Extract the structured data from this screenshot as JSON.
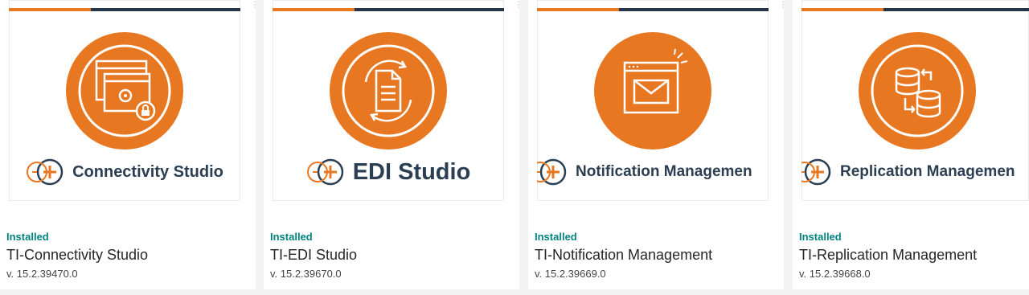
{
  "colors": {
    "accent": "#e87722",
    "navy": "#253447",
    "status_green": "#00827f",
    "page_bg": "#f3f3f3"
  },
  "cards": [
    {
      "brand": "Connectivity Studio",
      "icon": "connectivity-studio-icon",
      "status": "Installed",
      "name": "TI-Connectivity Studio",
      "version": "v. 15.2.39470.0"
    },
    {
      "brand": "EDI Studio",
      "icon": "edi-studio-icon",
      "status": "Installed",
      "name": "TI-EDI Studio",
      "version": "v. 15.2.39670.0"
    },
    {
      "brand": "Notification Managemen",
      "icon": "notification-management-icon",
      "status": "Installed",
      "name": "TI-Notification Management",
      "version": "v. 15.2.39669.0"
    },
    {
      "brand": "Replication Managemen",
      "icon": "replication-management-icon",
      "status": "Installed",
      "name": "TI-Replication Management",
      "version": "v. 15.2.39668.0"
    }
  ]
}
